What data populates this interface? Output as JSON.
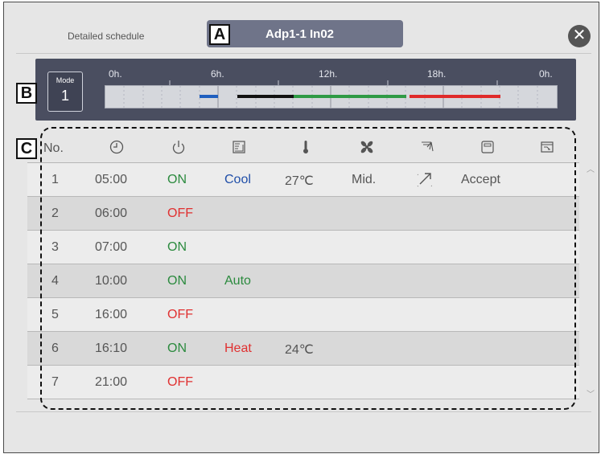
{
  "header": {
    "title": "Detailed schedule",
    "unit_name": "Adp1-1 In02",
    "close_glyph": "✕"
  },
  "callouts": {
    "a": "A",
    "b": "B",
    "c": "C"
  },
  "timeline": {
    "mode_label": "Mode",
    "mode_value": "1",
    "ticks": [
      "0h.",
      "6h.",
      "12h.",
      "18h.",
      "0h."
    ],
    "segments": [
      {
        "from_h": 5.0,
        "to_h": 6.0,
        "color": "#1f5fbf"
      },
      {
        "from_h": 7.0,
        "to_h": 10.0,
        "color": "#111111"
      },
      {
        "from_h": 10.0,
        "to_h": 16.0,
        "color": "#2e9a45"
      },
      {
        "from_h": 16.17,
        "to_h": 21.0,
        "color": "#e02a2a"
      }
    ]
  },
  "table": {
    "columns": {
      "no": "No.",
      "time_icon": "clock-icon",
      "power_icon": "power-icon",
      "mode_icon": "mode-icon",
      "temp_icon": "thermometer-icon",
      "fan_icon": "fan-icon",
      "vane_icon": "air-direction-icon",
      "ext_icon": "remote-icon",
      "misc_icon": "setting-icon"
    },
    "rows": [
      {
        "no": "1",
        "time": "05:00",
        "power": "ON",
        "mode": "Cool",
        "temp": "27℃",
        "fan": "Mid.",
        "vane": "↗",
        "ext": "Accept"
      },
      {
        "no": "2",
        "time": "06:00",
        "power": "OFF",
        "mode": "",
        "temp": "",
        "fan": "",
        "vane": "",
        "ext": ""
      },
      {
        "no": "3",
        "time": "07:00",
        "power": "ON",
        "mode": "",
        "temp": "",
        "fan": "",
        "vane": "",
        "ext": ""
      },
      {
        "no": "4",
        "time": "10:00",
        "power": "ON",
        "mode": "Auto",
        "temp": "",
        "fan": "",
        "vane": "",
        "ext": ""
      },
      {
        "no": "5",
        "time": "16:00",
        "power": "OFF",
        "mode": "",
        "temp": "",
        "fan": "",
        "vane": "",
        "ext": ""
      },
      {
        "no": "6",
        "time": "16:10",
        "power": "ON",
        "mode": "Heat",
        "temp": "24℃",
        "fan": "",
        "vane": "",
        "ext": ""
      },
      {
        "no": "7",
        "time": "21:00",
        "power": "OFF",
        "mode": "",
        "temp": "",
        "fan": "",
        "vane": "",
        "ext": ""
      }
    ]
  }
}
